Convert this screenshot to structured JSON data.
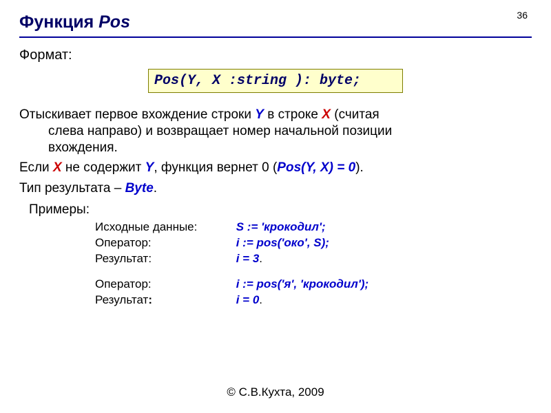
{
  "pageNumber": "36",
  "title": {
    "plain": "Функция ",
    "emph": "Pos"
  },
  "formatLabel": "Формат:",
  "codeSignature": "Pos(Y, X :string ): byte;",
  "desc": {
    "line1a": "Отыскивает первое вхождение строки ",
    "Y": "Y",
    "line1b": " в строке ",
    "X": "X",
    "line1c": " (считая",
    "indent1": "слева направо) и возвращает номер начальной позиции",
    "indent2": "вхождения."
  },
  "cond": {
    "a": "Если ",
    "X": "X",
    "b": " не содержит ",
    "Y": "Y",
    "c": ", функция вернет 0 (",
    "pos": "Pos(Y, X) = 0",
    "d": ")."
  },
  "typeLine": {
    "a": "Тип результата – ",
    "byte": "Byte",
    "dot": "."
  },
  "examplesLabel": "Примеры:",
  "ex": {
    "r1l": "Исходные данные:",
    "r1v": "S := 'крокодил';",
    "r2l": "Оператор:",
    "r2v": "i := pos('око', S);",
    "r3l": "Результат:",
    "r3v": "i = 3",
    "r4l": "Оператор:",
    "r4v": "i := pos('я', 'крокодил');",
    "r5l": "Результат",
    "r5colon": ":",
    "r5v": "i = 0",
    "dot": "."
  },
  "footer": "© С.В.Кухта, 2009"
}
